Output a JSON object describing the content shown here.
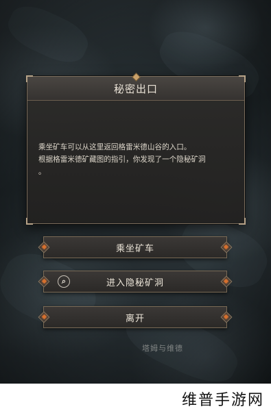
{
  "dialog": {
    "title": "秘密出口",
    "body_line1": "乘坐矿车可以从这里返回格雷米德山谷的入口。",
    "body_line2": "根据格雷米德矿藏图的指引，你发现了一个隐秘矿洞",
    "body_line3": "。"
  },
  "options": [
    {
      "label": "乘坐矿车"
    },
    {
      "label": "进入隐秘矿洞",
      "icon": "search-icon"
    },
    {
      "label": "离开"
    }
  ],
  "background_text": "塔姆与维德",
  "watermark": "维普手游网",
  "colors": {
    "accent": "#d6702e",
    "border": "#7b6d5c"
  }
}
